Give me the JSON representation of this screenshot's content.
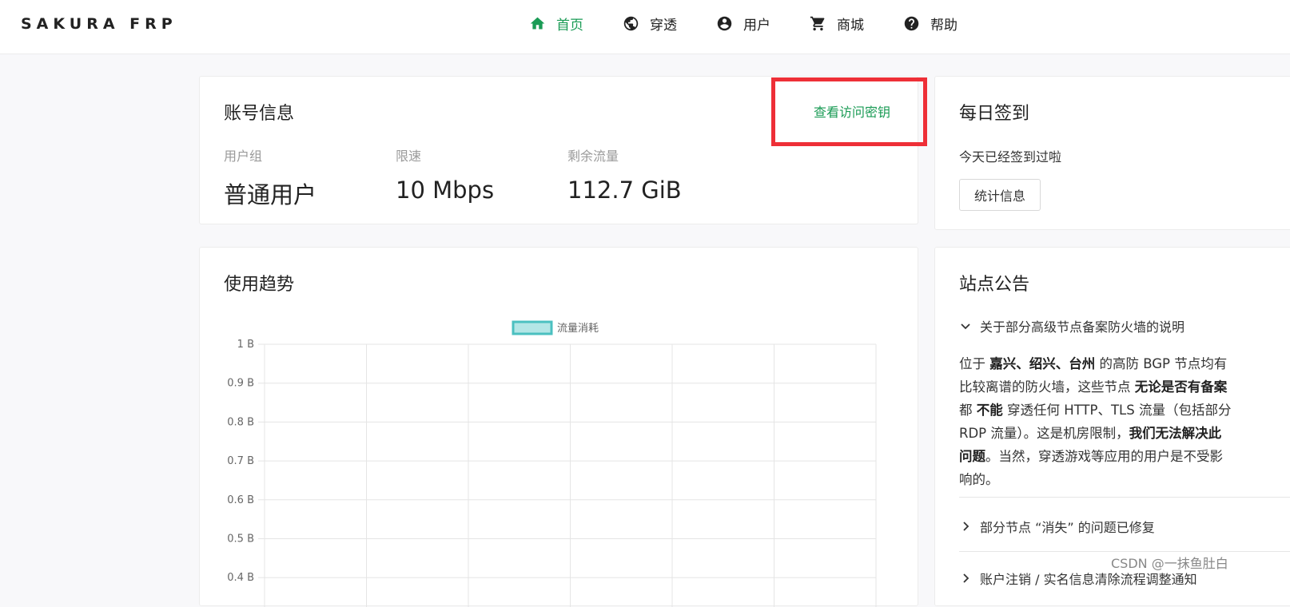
{
  "brand": "SAKURA FRP",
  "nav": [
    {
      "label": "首页",
      "icon": "home-icon",
      "active": true
    },
    {
      "label": "穿透",
      "icon": "globe-icon",
      "active": false
    },
    {
      "label": "用户",
      "icon": "user-circle-icon",
      "active": false
    },
    {
      "label": "商城",
      "icon": "cart-icon",
      "active": false
    },
    {
      "label": "帮助",
      "icon": "help-circle-icon",
      "active": false
    }
  ],
  "account": {
    "title": "账号信息",
    "key_link": "查看访问密钥",
    "stats": [
      {
        "label": "用户组",
        "value": "普通用户"
      },
      {
        "label": "限速",
        "value": "10 Mbps"
      },
      {
        "label": "剩余流量",
        "value": "112.7 GiB"
      }
    ]
  },
  "signin": {
    "title": "每日签到",
    "status": "今天已经签到过啦",
    "button": "统计信息"
  },
  "trend": {
    "title": "使用趋势"
  },
  "chart_data": {
    "type": "line",
    "series": [
      {
        "name": "流量消耗",
        "values": []
      }
    ],
    "y_ticks": [
      "1 B",
      "0.9 B",
      "0.8 B",
      "0.7 B",
      "0.6 B",
      "0.5 B",
      "0.4 B"
    ],
    "ylim": [
      0,
      1
    ],
    "grid": true,
    "legend": "top-center",
    "colors": {
      "series_border": "#4bc0c0",
      "series_fill": "#b3e6e6",
      "grid": "#e5e5e5"
    }
  },
  "notice": {
    "title": "站点公告",
    "items": [
      {
        "title": "关于部分高级节点备案防火墙的说明",
        "expanded": true
      },
      {
        "title": "部分节点 “消失” 的问题已修复",
        "expanded": false
      },
      {
        "title": "账户注销 / 实名信息清除流程调整通知",
        "expanded": false
      }
    ],
    "body": {
      "l1a": "位于 ",
      "l1b": "嘉兴、绍兴、台州",
      "l1c": " 的高防 BGP 节点均有",
      "l2a": "比较离谱的防火墙，这些节点 ",
      "l2b": "无论是否有备案",
      "l3a": "都 ",
      "l3b": "不能",
      "l3c": " 穿透任何 HTTP、TLS 流量（包括部分",
      "l4a": "RDP 流量）。这是机房限制，",
      "l4b": "我们无法解决此",
      "l5a": "问题",
      "l5b": "。当然，穿透游戏等应用的用户是不受影",
      "l6": "响的。"
    }
  },
  "watermark": "CSDN @一抹鱼肚白",
  "accent": "#1a9b55",
  "highlight_color": "#ee2f37"
}
